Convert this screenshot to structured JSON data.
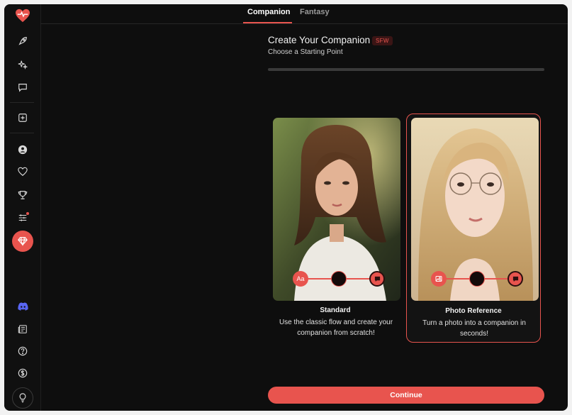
{
  "tabs": [
    {
      "label": "Companion"
    },
    {
      "label": "Fantasy"
    }
  ],
  "page": {
    "title": "Create Your Companion",
    "badge": "SFW",
    "subtitle": "Choose a Starting Point"
  },
  "progress": {
    "value": 0
  },
  "cards": [
    {
      "label": "Standard",
      "description": "Use the classic flow and create your companion from scratch!",
      "selected": false,
      "flow_first_icon": "Aa"
    },
    {
      "label": "Photo Reference",
      "description": "Turn a photo into a companion in seconds!",
      "selected": true,
      "flow_first_icon": "image-icon"
    }
  ],
  "continue_label": "Continue",
  "sidebar": {
    "items": [
      "heart-pulse-icon",
      "rocket-icon",
      "sparkles-icon",
      "chat-icon",
      "plus-square-icon",
      "user-icon",
      "heart-icon",
      "trophy-icon",
      "sliders-icon",
      "diamond-icon",
      "discord-icon",
      "newspaper-icon",
      "help-icon",
      "dollar-icon",
      "lightbulb-icon"
    ]
  },
  "colors": {
    "accent": "#e8544e",
    "background": "#0e0e0e"
  }
}
